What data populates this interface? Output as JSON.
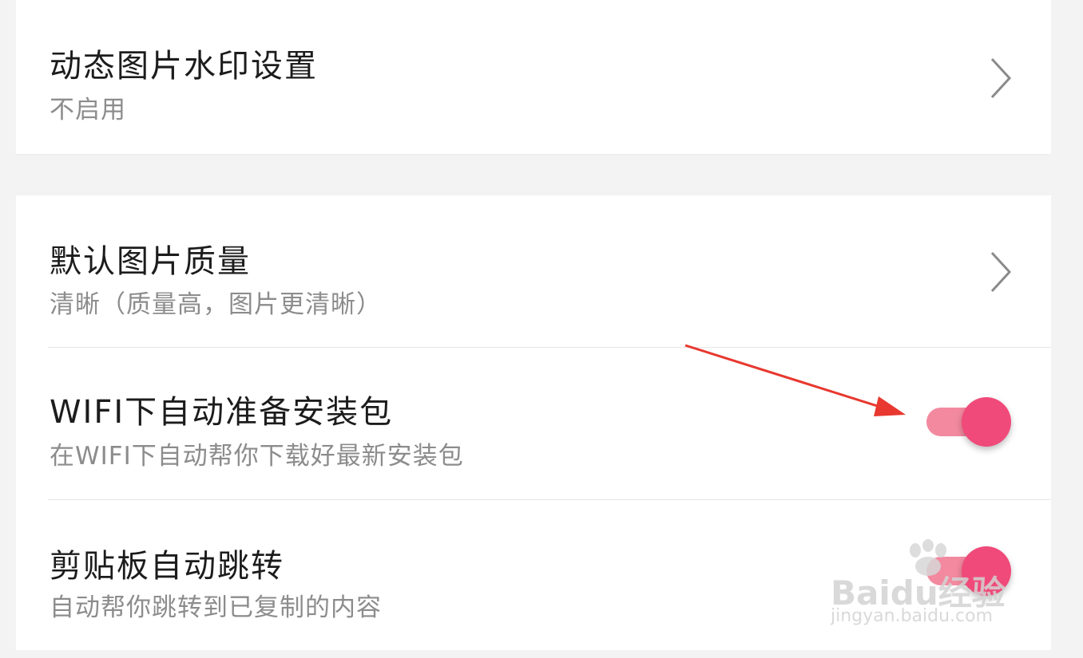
{
  "settings": {
    "watermark_row": {
      "title": "动态图片水印设置",
      "subtitle": "不启用"
    },
    "quality_row": {
      "title": "默认图片质量",
      "subtitle": "清晰（质量高，图片更清晰）"
    },
    "wifi_row": {
      "title": "WIFI下自动准备安装包",
      "subtitle": "在WIFI下自动帮你下载好最新安装包",
      "enabled": true
    },
    "clipboard_row": {
      "title": "剪贴板自动跳转",
      "subtitle": "自动帮你跳转到已复制的内容",
      "enabled": true
    }
  },
  "overlay": {
    "brand_watermark": "Baidu经验",
    "brand_url": "jingyan.baidu.com"
  },
  "colors": {
    "toggle_knob": "#f04a7a",
    "toggle_track": "#f2899f",
    "annotation_arrow": "#e8382f"
  }
}
